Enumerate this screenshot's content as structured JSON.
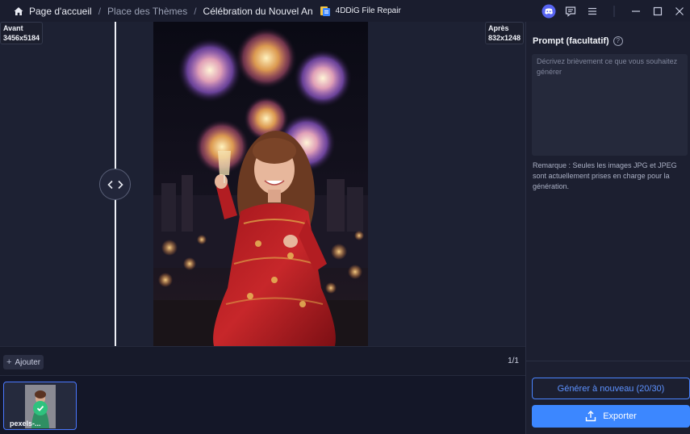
{
  "breadcrumb": {
    "home": "Page d'accueil",
    "themes": "Place des Thèmes",
    "current": "Célébration du Nouvel An"
  },
  "app": {
    "name": "4DDiG File Repair"
  },
  "compare": {
    "before_label": "Avant",
    "before_size": "3456x5184",
    "after_label": "Après",
    "after_size": "832x1248"
  },
  "toolbar": {
    "add_label": "Ajouter",
    "page_counter": "1/1"
  },
  "thumbnails": [
    {
      "name": "pexels-..."
    }
  ],
  "panel": {
    "prompt_title": "Prompt (facultatif)",
    "prompt_placeholder": "Décrivez brièvement ce que vous souhaitez générer",
    "prompt_value": "",
    "note": "Remarque : Seules les images JPG et JPEG sont actuellement prises en charge pour la génération.",
    "regenerate_label": "Générer à nouveau (20/30)",
    "export_label": "Exporter"
  },
  "colors": {
    "accent": "#3c87ff",
    "background": "#171a2b",
    "panel": "#1c1f30",
    "success": "#2ec27e"
  },
  "icons": [
    "home-icon",
    "app-logo-icon",
    "discord-icon",
    "feedback-icon",
    "menu-icon",
    "minimize-icon",
    "maximize-icon",
    "close-icon",
    "compare-handle-icon",
    "help-icon",
    "plus-icon",
    "check-icon",
    "export-icon"
  ]
}
